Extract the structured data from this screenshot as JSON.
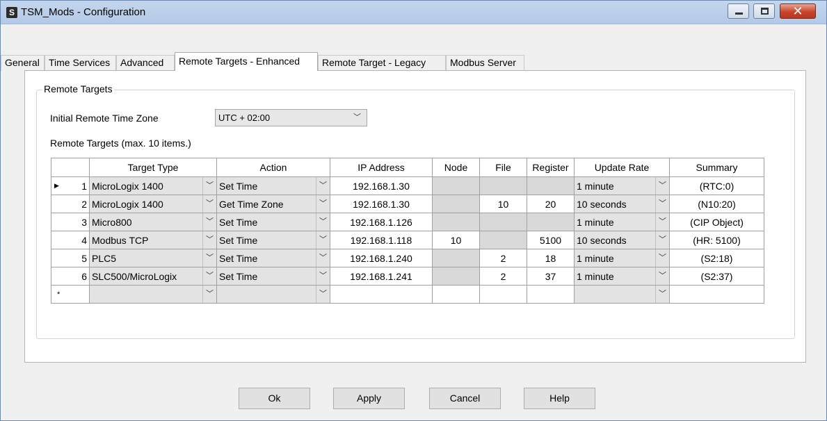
{
  "window": {
    "icon": "S",
    "title": "TSM_Mods - Configuration",
    "minimize": "minimize",
    "maximize": "maximize",
    "close": "✕"
  },
  "tabs": [
    {
      "label": "General"
    },
    {
      "label": "Time Services"
    },
    {
      "label": "Advanced"
    },
    {
      "label": "Remote Targets - Enhanced"
    },
    {
      "label": "Remote Target - Legacy"
    },
    {
      "label": "Modbus Server"
    }
  ],
  "group": {
    "legend": "Remote Targets",
    "tz_label": "Initial Remote Time Zone",
    "tz_value": "UTC + 02:00",
    "max_label": "Remote Targets (max. 10 items.)"
  },
  "grid": {
    "headers": [
      "",
      "Target Type",
      "Action",
      "IP Address",
      "Node",
      "File",
      "Register",
      "Update Rate",
      "Summary"
    ],
    "rows": [
      {
        "num": "1",
        "type": "MicroLogix 1400",
        "action": "Set Time",
        "ip": "192.168.1.30",
        "node": "",
        "file": "",
        "register": "",
        "rate": "1 minute",
        "summary": "(RTC:0)"
      },
      {
        "num": "2",
        "type": "MicroLogix 1400",
        "action": "Get Time Zone",
        "ip": "192.168.1.30",
        "node": "",
        "file": "10",
        "register": "20",
        "rate": "10 seconds",
        "summary": "(N10:20)"
      },
      {
        "num": "3",
        "type": "Micro800",
        "action": "Set Time",
        "ip": "192.168.1.126",
        "node": "",
        "file": "",
        "register": "",
        "rate": "1 minute",
        "summary": "(CIP Object)"
      },
      {
        "num": "4",
        "type": "Modbus TCP",
        "action": "Set Time",
        "ip": "192.168.1.118",
        "node": "10",
        "file": "",
        "register": "5100",
        "rate": "10 seconds",
        "summary": "(HR: 5100)"
      },
      {
        "num": "5",
        "type": "PLC5",
        "action": "Set Time",
        "ip": "192.168.1.240",
        "node": "",
        "file": "2",
        "register": "18",
        "rate": "1 minute",
        "summary": "(S2:18)"
      },
      {
        "num": "6",
        "type": "SLC500/MicroLogix",
        "action": "Set Time",
        "ip": "192.168.1.241",
        "node": "",
        "file": "2",
        "register": "37",
        "rate": "1 minute",
        "summary": "(S2:37)"
      }
    ],
    "new_row_marker": "*",
    "current_row_marker": "▶"
  },
  "buttons": {
    "ok": "Ok",
    "apply": "Apply",
    "cancel": "Cancel",
    "help": "Help"
  },
  "glyphs": {
    "chevron": "﹀"
  }
}
